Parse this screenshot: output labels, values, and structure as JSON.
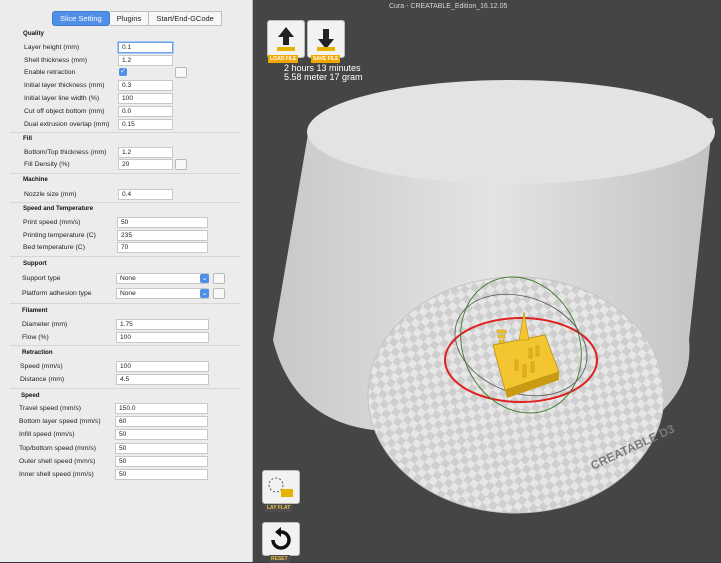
{
  "window": {
    "title": "Cura - CREATABLE_Edition_16.12.05"
  },
  "tabs": [
    "Slice Setting",
    "Plugins",
    "Start/End-GCode"
  ],
  "sections": {
    "quality": "Quality",
    "fill": "Fill",
    "machine": "Machine",
    "speed_temp": "Speed and Temperature",
    "support": "Support",
    "filament": "Filament",
    "retraction": "Retraction",
    "speed": "Speed"
  },
  "quality": [
    {
      "label": "Layer height (mm)",
      "value": "0.1"
    },
    {
      "label": "Shell thickness (mm)",
      "value": "1.2"
    },
    {
      "label": "Enable retraction",
      "value": "✓"
    },
    {
      "label": "Initial layer thickness (mm)",
      "value": "0.3"
    },
    {
      "label": "Initial layer line width (%)",
      "value": "100"
    },
    {
      "label": "Cut off object bottom (mm)",
      "value": "0.0"
    },
    {
      "label": "Dual extrusion overlap (mm)",
      "value": "0.15"
    }
  ],
  "fill": [
    {
      "label": "Bottom/Top thickness (mm)",
      "value": "1.2"
    },
    {
      "label": "Fill Density (%)",
      "value": "20"
    }
  ],
  "machine": [
    {
      "label": "Nozzle size (mm)",
      "value": "0.4"
    }
  ],
  "speed_temp": [
    {
      "label": "Print speed (mm/s)",
      "value": "50"
    },
    {
      "label": "Printing temperature (C)",
      "value": "235"
    },
    {
      "label": "Bed temperature (C)",
      "value": "70"
    }
  ],
  "support": [
    {
      "label": "Support type",
      "value": "None"
    },
    {
      "label": "Platform adhesion type",
      "value": "None"
    }
  ],
  "filament": [
    {
      "label": "Diameter (mm)",
      "value": "1.75"
    },
    {
      "label": "Flow (%)",
      "value": "100"
    }
  ],
  "retraction": [
    {
      "label": "Speed (mm/s)",
      "value": "100"
    },
    {
      "label": "Distance (mm)",
      "value": "4.5"
    }
  ],
  "speed": [
    {
      "label": "Travel speed (mm/s)",
      "value": "150.0"
    },
    {
      "label": "Bottom layer speed (mm/s)",
      "value": "60"
    },
    {
      "label": "Infill speed (mm/s)",
      "value": "50"
    },
    {
      "label": "Top/bottom speed (mm/s)",
      "value": "50"
    },
    {
      "label": "Outer shell speed (mm/s)",
      "value": "50"
    },
    {
      "label": "Inner shell speed (mm/s)",
      "value": "50"
    }
  ],
  "toolbar": {
    "load_label": "LOAD FILE",
    "save_label": "SAVE FILE",
    "layflat_label": "LAY FLAT",
    "reset_label": "RESET"
  },
  "print_info": {
    "time": "2 hours 13 minutes",
    "material": "5.58 meter 17 gram"
  },
  "bed_brand": "CREATABLE D3",
  "colors": {
    "accent": "#4f8fe6",
    "model": "#f2c531",
    "selection": "#e02020",
    "button_label": "#f0a800"
  }
}
